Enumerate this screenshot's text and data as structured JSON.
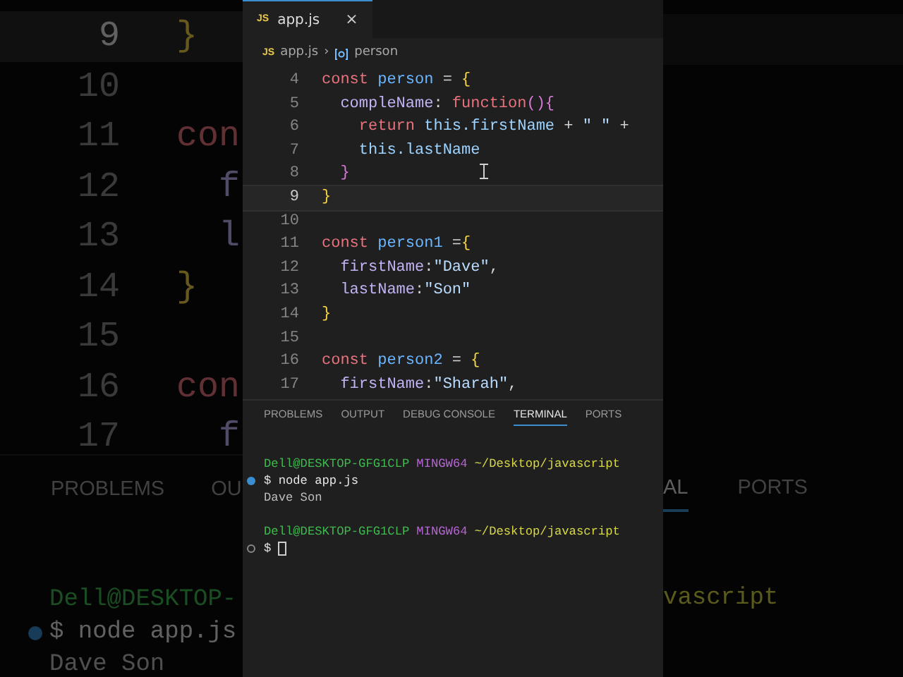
{
  "backdrop_left": {
    "lines": [
      {
        "number": "9",
        "selected": true,
        "tokens": [
          {
            "kind": "brace",
            "text": "}"
          }
        ]
      },
      {
        "number": "10",
        "selected": false
      },
      {
        "number": "11",
        "selected": false,
        "tokens": [
          {
            "kind": "keyword",
            "text": "con"
          }
        ]
      },
      {
        "number": "12",
        "selected": false,
        "tokens": [
          {
            "kind": "property",
            "text": "  f"
          }
        ]
      },
      {
        "number": "13",
        "selected": false,
        "tokens": [
          {
            "kind": "property",
            "text": "  l"
          }
        ]
      },
      {
        "number": "14",
        "selected": false,
        "tokens": [
          {
            "kind": "brace",
            "text": "}"
          }
        ]
      },
      {
        "number": "15",
        "selected": false
      },
      {
        "number": "16",
        "selected": false,
        "tokens": [
          {
            "kind": "keyword",
            "text": "con"
          }
        ]
      },
      {
        "number": "17",
        "selected": false,
        "tokens": [
          {
            "kind": "property",
            "text": "  f"
          }
        ]
      }
    ],
    "panel_tabs": [
      {
        "label": "PROBLEMS",
        "selected": false
      },
      {
        "label": "OU",
        "selected": false
      }
    ],
    "terminal": [
      {
        "kind": "prompt",
        "segments": [
          {
            "kind": "user",
            "text": "Dell@DESKTOP-"
          }
        ]
      },
      {
        "kind": "command",
        "done": true,
        "segments": [
          {
            "kind": "plain",
            "text": "$ node app.js"
          }
        ]
      },
      {
        "kind": "output",
        "segments": [
          {
            "kind": "plain",
            "text": "Dave Son"
          }
        ]
      }
    ]
  },
  "editor": {
    "tabs": [
      {
        "label": "app.js",
        "icon": "JS",
        "selected": true,
        "close": "×"
      }
    ],
    "breadcrumb": {
      "file_icon": "JS",
      "file": "app.js",
      "separator": "›",
      "symbol": "person"
    },
    "lines": [
      {
        "number": "4",
        "selected": false,
        "tokens": [
          {
            "kind": "keyword",
            "text": "const"
          },
          {
            "kind": "name",
            "text": " person"
          },
          {
            "kind": "punct",
            "text": " = "
          },
          {
            "kind": "brace",
            "text": "{"
          }
        ]
      },
      {
        "number": "5",
        "selected": false,
        "tokens": [
          {
            "kind": "property",
            "text": "  compleName"
          },
          {
            "kind": "punct",
            "text": ": "
          },
          {
            "kind": "keyword",
            "text": "function"
          },
          {
            "kind": "brace2",
            "text": "(){"
          }
        ]
      },
      {
        "number": "6",
        "selected": false,
        "tokens": [
          {
            "kind": "keyword",
            "text": "    return"
          },
          {
            "kind": "variable",
            "text": " this.firstName"
          },
          {
            "kind": "punct",
            "text": " + "
          },
          {
            "kind": "string",
            "text": "\" \""
          },
          {
            "kind": "punct",
            "text": " +"
          }
        ]
      },
      {
        "number": "7",
        "selected": false,
        "tokens": [
          {
            "kind": "variable",
            "text": "    this.lastName"
          }
        ]
      },
      {
        "number": "8",
        "selected": false,
        "tokens": [
          {
            "kind": "brace2",
            "text": "  }"
          }
        ]
      },
      {
        "number": "9",
        "selected": true,
        "tokens": [
          {
            "kind": "brace",
            "text": "}"
          }
        ]
      },
      {
        "number": "10",
        "selected": false
      },
      {
        "number": "11",
        "selected": false,
        "tokens": [
          {
            "kind": "keyword",
            "text": "const"
          },
          {
            "kind": "name",
            "text": " person1"
          },
          {
            "kind": "punct",
            "text": " ="
          },
          {
            "kind": "brace",
            "text": "{"
          }
        ]
      },
      {
        "number": "12",
        "selected": false,
        "tokens": [
          {
            "kind": "property",
            "text": "  firstName"
          },
          {
            "kind": "punct",
            "text": ":"
          },
          {
            "kind": "string",
            "text": "\"Dave\""
          },
          {
            "kind": "punct",
            "text": ","
          }
        ]
      },
      {
        "number": "13",
        "selected": false,
        "tokens": [
          {
            "kind": "property",
            "text": "  lastName"
          },
          {
            "kind": "punct",
            "text": ":"
          },
          {
            "kind": "string",
            "text": "\"Son\""
          }
        ]
      },
      {
        "number": "14",
        "selected": false,
        "tokens": [
          {
            "kind": "brace",
            "text": "}"
          }
        ]
      },
      {
        "number": "15",
        "selected": false
      },
      {
        "number": "16",
        "selected": false,
        "tokens": [
          {
            "kind": "keyword",
            "text": "const"
          },
          {
            "kind": "name",
            "text": " person2"
          },
          {
            "kind": "punct",
            "text": " = "
          },
          {
            "kind": "brace",
            "text": "{"
          }
        ]
      },
      {
        "number": "17",
        "selected": false,
        "tokens": [
          {
            "kind": "property",
            "text": "  firstName"
          },
          {
            "kind": "punct",
            "text": ":"
          },
          {
            "kind": "string",
            "text": "\"Sharah\""
          },
          {
            "kind": "punct",
            "text": ","
          }
        ]
      }
    ]
  },
  "panel": {
    "tabs": [
      {
        "label": "PROBLEMS",
        "selected": false
      },
      {
        "label": "OUTPUT",
        "selected": false
      },
      {
        "label": "DEBUG CONSOLE",
        "selected": false
      },
      {
        "label": "TERMINAL",
        "selected": true
      },
      {
        "label": "PORTS",
        "selected": false
      }
    ],
    "terminal": [
      {
        "kind": "prompt",
        "segments": [
          {
            "kind": "user",
            "text": "Dell@DESKTOP-GFG1CLP"
          },
          {
            "kind": "host",
            "text": "MINGW64"
          },
          {
            "kind": "path",
            "text": "~/Desktop/javascript"
          }
        ]
      },
      {
        "kind": "command",
        "done": true,
        "segments": [
          {
            "kind": "plain",
            "text": "$ node app.js"
          }
        ]
      },
      {
        "kind": "output",
        "segments": [
          {
            "kind": "plain",
            "text": "Dave Son"
          }
        ]
      },
      {
        "kind": "blank"
      },
      {
        "kind": "prompt",
        "segments": [
          {
            "kind": "user",
            "text": "Dell@DESKTOP-GFG1CLP"
          },
          {
            "kind": "host",
            "text": "MINGW64"
          },
          {
            "kind": "path",
            "text": "~/Desktop/javascript"
          }
        ]
      },
      {
        "kind": "command",
        "done": false,
        "cursor": true,
        "segments": [
          {
            "kind": "plain",
            "text": "$"
          }
        ]
      }
    ]
  },
  "backdrop_right": {
    "panel_tabs": [
      {
        "label": "AL",
        "selected": true
      },
      {
        "label": "PORTS",
        "selected": false
      }
    ],
    "terminal": [
      {
        "kind": "prompt",
        "segments": [
          {
            "kind": "path",
            "text": "vascript"
          }
        ]
      }
    ]
  }
}
